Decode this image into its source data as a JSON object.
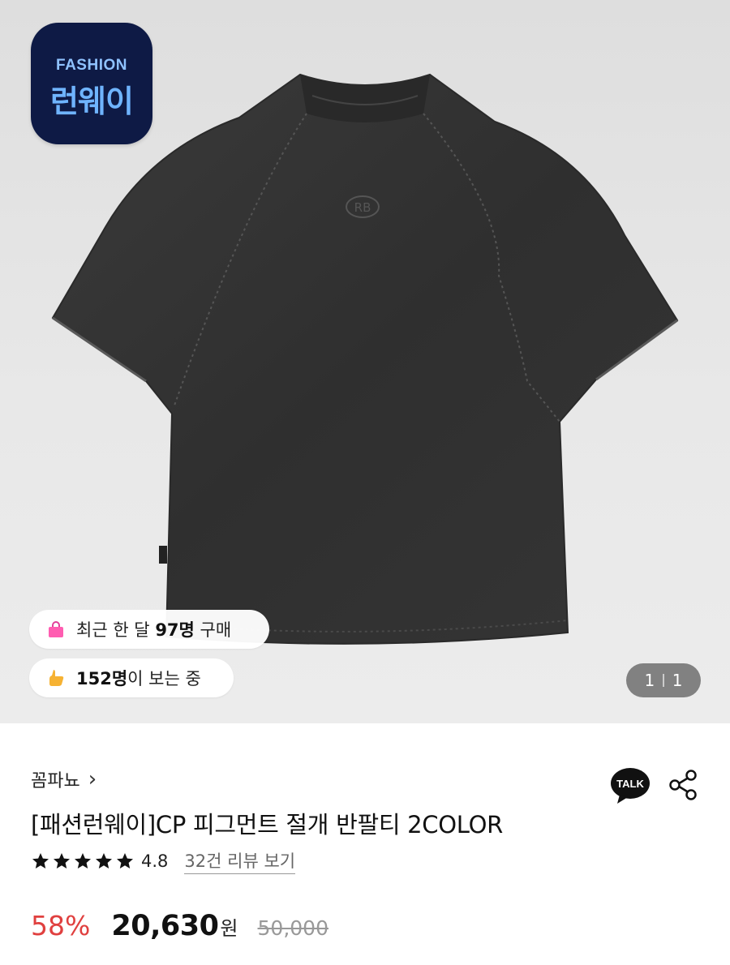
{
  "brand_badge": {
    "small_text": "FASHION",
    "big_text": "런웨이",
    "bg_color": "#0e1a45",
    "text_color": "#6fb4ff"
  },
  "badges": {
    "recent_purchase": {
      "prefix": "최근 한 달 ",
      "count": "97명",
      "suffix": " 구매",
      "icon": "shopping-bag-icon"
    },
    "viewing": {
      "count": "152명",
      "suffix": "이 보는 중",
      "icon": "thumbs-up-hand-icon"
    }
  },
  "pager": {
    "current": "1",
    "total": "1"
  },
  "seller": {
    "name": "꼼파뇨",
    "chevron": "›"
  },
  "product": {
    "title": "[패션런웨이]CP 피그먼트 절개 반팔티 2COLOR",
    "rating": "4.8",
    "stars": 5,
    "review_link": "32건 리뷰 보기"
  },
  "price": {
    "discount": "58%",
    "amount": "20,630",
    "currency": "원",
    "original": "50,000",
    "discount_color": "#e0403f"
  },
  "actions": {
    "talk_label": "TALK",
    "share_icon": "share-icon"
  }
}
